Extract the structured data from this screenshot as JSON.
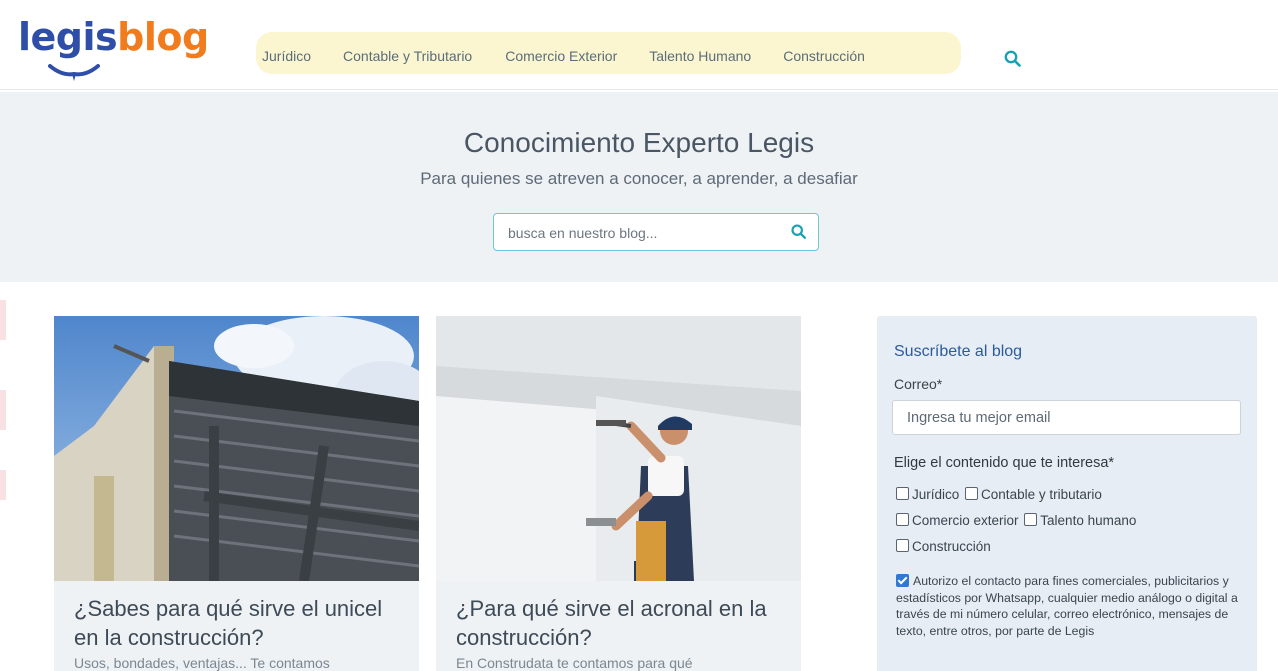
{
  "header": {
    "logo": {
      "part1": "legis",
      "part2": "blog"
    },
    "nav": [
      "Jurídico",
      "Contable y Tributario",
      "Comercio Exterior",
      "Talento Humano",
      "Construcción"
    ],
    "search_icon": "search-icon"
  },
  "hero": {
    "title": "Conocimiento Experto Legis",
    "subtitle": "Para quienes se atreven a conocer, a aprender, a desafiar",
    "search_placeholder": "busca en nuestro blog..."
  },
  "cards": [
    {
      "title": "¿Sabes para qué sirve el unicel en la construcción?",
      "excerpt": "Usos, bondades, ventajas... Te contamos"
    },
    {
      "title": "¿Para qué sirve el acronal en la construcción?",
      "excerpt": "En Construdata te contamos para qué"
    }
  ],
  "sidebar": {
    "title": "Suscríbete al blog",
    "email_label": "Correo*",
    "email_placeholder": "Ingresa tu mejor email",
    "interest_label": "Elige el contenido que te interesa*",
    "options": [
      "Jurídico",
      "Contable y tributario",
      "Comercio exterior",
      "Talento humano",
      "Construcción"
    ],
    "consent": "Autorizo el contacto para fines comerciales, publicitarios y estadísticos por Whatsapp, cualquier medio análogo o digital a través de mi número celular, correo electrónico, mensajes de texto, entre otros, por parte de Legis",
    "consent_checked": true
  },
  "colors": {
    "brand_blue": "#2f4ea8",
    "brand_orange": "#f07c1e",
    "accent_teal": "#1aa0b5",
    "checkbox_blue": "#2f78d4"
  }
}
